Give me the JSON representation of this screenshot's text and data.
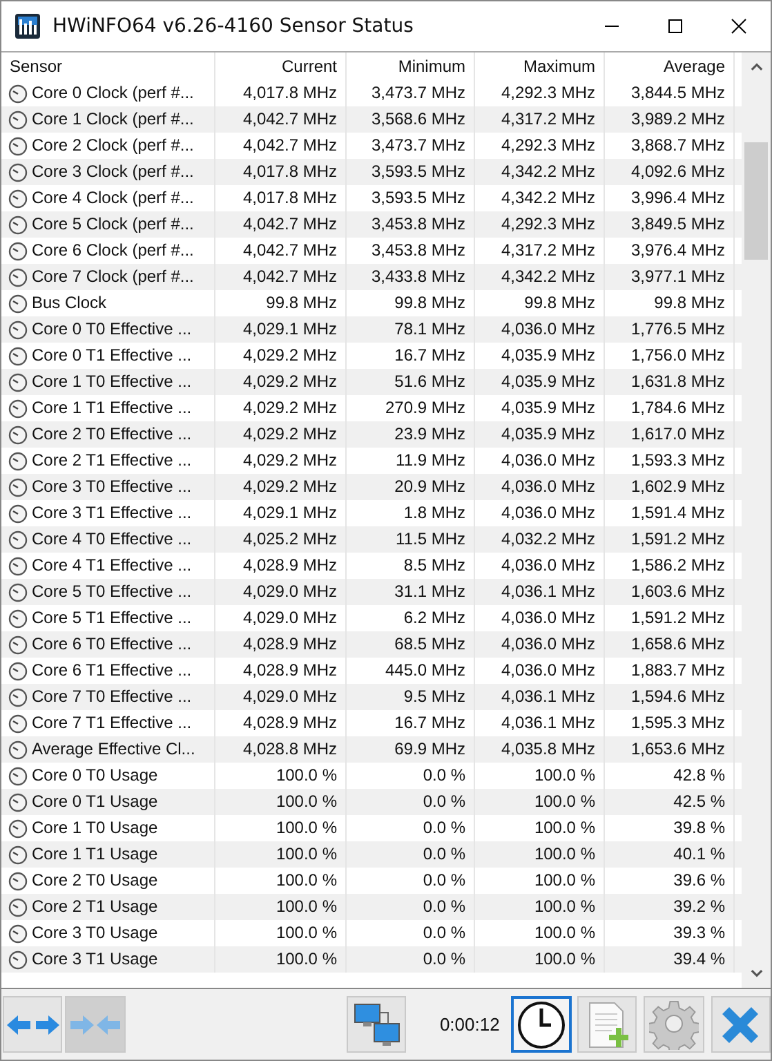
{
  "window": {
    "title": "HWiNFO64 v6.26-4160 Sensor Status"
  },
  "table": {
    "columns": [
      "Sensor",
      "Current",
      "Minimum",
      "Maximum",
      "Average"
    ],
    "rows": [
      [
        "Core 0 Clock (perf #...",
        "4,017.8 MHz",
        "3,473.7 MHz",
        "4,292.3 MHz",
        "3,844.5 MHz"
      ],
      [
        "Core 1 Clock (perf #...",
        "4,042.7 MHz",
        "3,568.6 MHz",
        "4,317.2 MHz",
        "3,989.2 MHz"
      ],
      [
        "Core 2 Clock (perf #...",
        "4,042.7 MHz",
        "3,473.7 MHz",
        "4,292.3 MHz",
        "3,868.7 MHz"
      ],
      [
        "Core 3 Clock (perf #...",
        "4,017.8 MHz",
        "3,593.5 MHz",
        "4,342.2 MHz",
        "4,092.6 MHz"
      ],
      [
        "Core 4 Clock (perf #...",
        "4,017.8 MHz",
        "3,593.5 MHz",
        "4,342.2 MHz",
        "3,996.4 MHz"
      ],
      [
        "Core 5 Clock (perf #...",
        "4,042.7 MHz",
        "3,453.8 MHz",
        "4,292.3 MHz",
        "3,849.5 MHz"
      ],
      [
        "Core 6 Clock (perf #...",
        "4,042.7 MHz",
        "3,453.8 MHz",
        "4,317.2 MHz",
        "3,976.4 MHz"
      ],
      [
        "Core 7 Clock (perf #...",
        "4,042.7 MHz",
        "3,433.8 MHz",
        "4,342.2 MHz",
        "3,977.1 MHz"
      ],
      [
        "Bus Clock",
        "99.8 MHz",
        "99.8 MHz",
        "99.8 MHz",
        "99.8 MHz"
      ],
      [
        "Core 0 T0 Effective ...",
        "4,029.1 MHz",
        "78.1 MHz",
        "4,036.0 MHz",
        "1,776.5 MHz"
      ],
      [
        "Core 0 T1 Effective ...",
        "4,029.2 MHz",
        "16.7 MHz",
        "4,035.9 MHz",
        "1,756.0 MHz"
      ],
      [
        "Core 1 T0 Effective ...",
        "4,029.2 MHz",
        "51.6 MHz",
        "4,035.9 MHz",
        "1,631.8 MHz"
      ],
      [
        "Core 1 T1 Effective ...",
        "4,029.2 MHz",
        "270.9 MHz",
        "4,035.9 MHz",
        "1,784.6 MHz"
      ],
      [
        "Core 2 T0 Effective ...",
        "4,029.2 MHz",
        "23.9 MHz",
        "4,035.9 MHz",
        "1,617.0 MHz"
      ],
      [
        "Core 2 T1 Effective ...",
        "4,029.2 MHz",
        "11.9 MHz",
        "4,036.0 MHz",
        "1,593.3 MHz"
      ],
      [
        "Core 3 T0 Effective ...",
        "4,029.2 MHz",
        "20.9 MHz",
        "4,036.0 MHz",
        "1,602.9 MHz"
      ],
      [
        "Core 3 T1 Effective ...",
        "4,029.1 MHz",
        "1.8 MHz",
        "4,036.0 MHz",
        "1,591.4 MHz"
      ],
      [
        "Core 4 T0 Effective ...",
        "4,025.2 MHz",
        "11.5 MHz",
        "4,032.2 MHz",
        "1,591.2 MHz"
      ],
      [
        "Core 4 T1 Effective ...",
        "4,028.9 MHz",
        "8.5 MHz",
        "4,036.0 MHz",
        "1,586.2 MHz"
      ],
      [
        "Core 5 T0 Effective ...",
        "4,029.0 MHz",
        "31.1 MHz",
        "4,036.1 MHz",
        "1,603.6 MHz"
      ],
      [
        "Core 5 T1 Effective ...",
        "4,029.0 MHz",
        "6.2 MHz",
        "4,036.0 MHz",
        "1,591.2 MHz"
      ],
      [
        "Core 6 T0 Effective ...",
        "4,028.9 MHz",
        "68.5 MHz",
        "4,036.0 MHz",
        "1,658.6 MHz"
      ],
      [
        "Core 6 T1 Effective ...",
        "4,028.9 MHz",
        "445.0 MHz",
        "4,036.0 MHz",
        "1,883.7 MHz"
      ],
      [
        "Core 7 T0 Effective ...",
        "4,029.0 MHz",
        "9.5 MHz",
        "4,036.1 MHz",
        "1,594.6 MHz"
      ],
      [
        "Core 7 T1 Effective ...",
        "4,028.9 MHz",
        "16.7 MHz",
        "4,036.1 MHz",
        "1,595.3 MHz"
      ],
      [
        "Average Effective Cl...",
        "4,028.8 MHz",
        "69.9 MHz",
        "4,035.8 MHz",
        "1,653.6 MHz"
      ],
      [
        "Core 0 T0 Usage",
        "100.0 %",
        "0.0 %",
        "100.0 %",
        "42.8 %"
      ],
      [
        "Core 0 T1 Usage",
        "100.0 %",
        "0.0 %",
        "100.0 %",
        "42.5 %"
      ],
      [
        "Core 1 T0 Usage",
        "100.0 %",
        "0.0 %",
        "100.0 %",
        "39.8 %"
      ],
      [
        "Core 1 T1 Usage",
        "100.0 %",
        "0.0 %",
        "100.0 %",
        "40.1 %"
      ],
      [
        "Core 2 T0 Usage",
        "100.0 %",
        "0.0 %",
        "100.0 %",
        "39.6 %"
      ],
      [
        "Core 2 T1 Usage",
        "100.0 %",
        "0.0 %",
        "100.0 %",
        "39.2 %"
      ],
      [
        "Core 3 T0 Usage",
        "100.0 %",
        "0.0 %",
        "100.0 %",
        "39.3 %"
      ],
      [
        "Core 3 T1 Usage",
        "100.0 %",
        "0.0 %",
        "100.0 %",
        "39.4 %"
      ]
    ]
  },
  "toolbar": {
    "buttons": [
      {
        "kind": "expand",
        "pressed": false,
        "focused": false
      },
      {
        "kind": "collapse",
        "pressed": true,
        "focused": false
      },
      {
        "kind": "network",
        "pressed": false,
        "focused": false
      },
      {
        "kind": "timer",
        "label": "0:00:12"
      },
      {
        "kind": "clock",
        "pressed": false,
        "focused": true
      },
      {
        "kind": "report",
        "pressed": false,
        "focused": false
      },
      {
        "kind": "settings",
        "pressed": false,
        "focused": false
      },
      {
        "kind": "close",
        "pressed": false,
        "focused": false
      }
    ]
  }
}
